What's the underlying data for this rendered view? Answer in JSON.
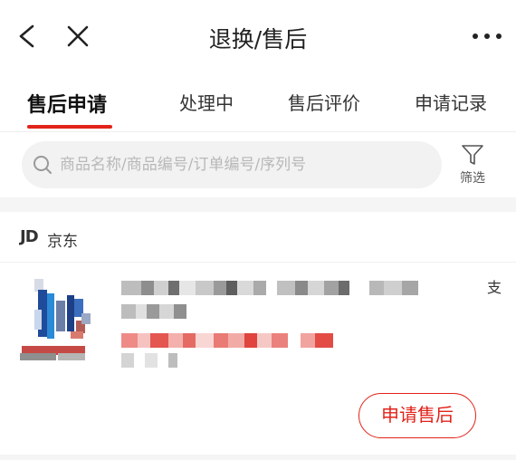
{
  "header": {
    "title": "退换/售后",
    "back_icon": "chevron-left-icon",
    "close_icon": "close-icon",
    "more_icon": "more-horizontal-icon"
  },
  "tabs": [
    {
      "label": "售后申请",
      "active": true
    },
    {
      "label": "处理中",
      "active": false
    },
    {
      "label": "售后评价",
      "active": false
    },
    {
      "label": "申请记录",
      "active": false
    }
  ],
  "search": {
    "placeholder": "商品名称/商品编号/订单编号/序列号",
    "value": "",
    "icon": "search-icon"
  },
  "filter": {
    "label": "筛选",
    "icon": "filter-funnel-icon"
  },
  "store": {
    "logo": "JD",
    "name": "京东"
  },
  "item": {
    "cut_char": "支",
    "apply_button": "申请售后"
  },
  "colors": {
    "accent": "#e2231a",
    "background_gap": "#f5f5f5",
    "search_bg": "#f2f2f2"
  }
}
